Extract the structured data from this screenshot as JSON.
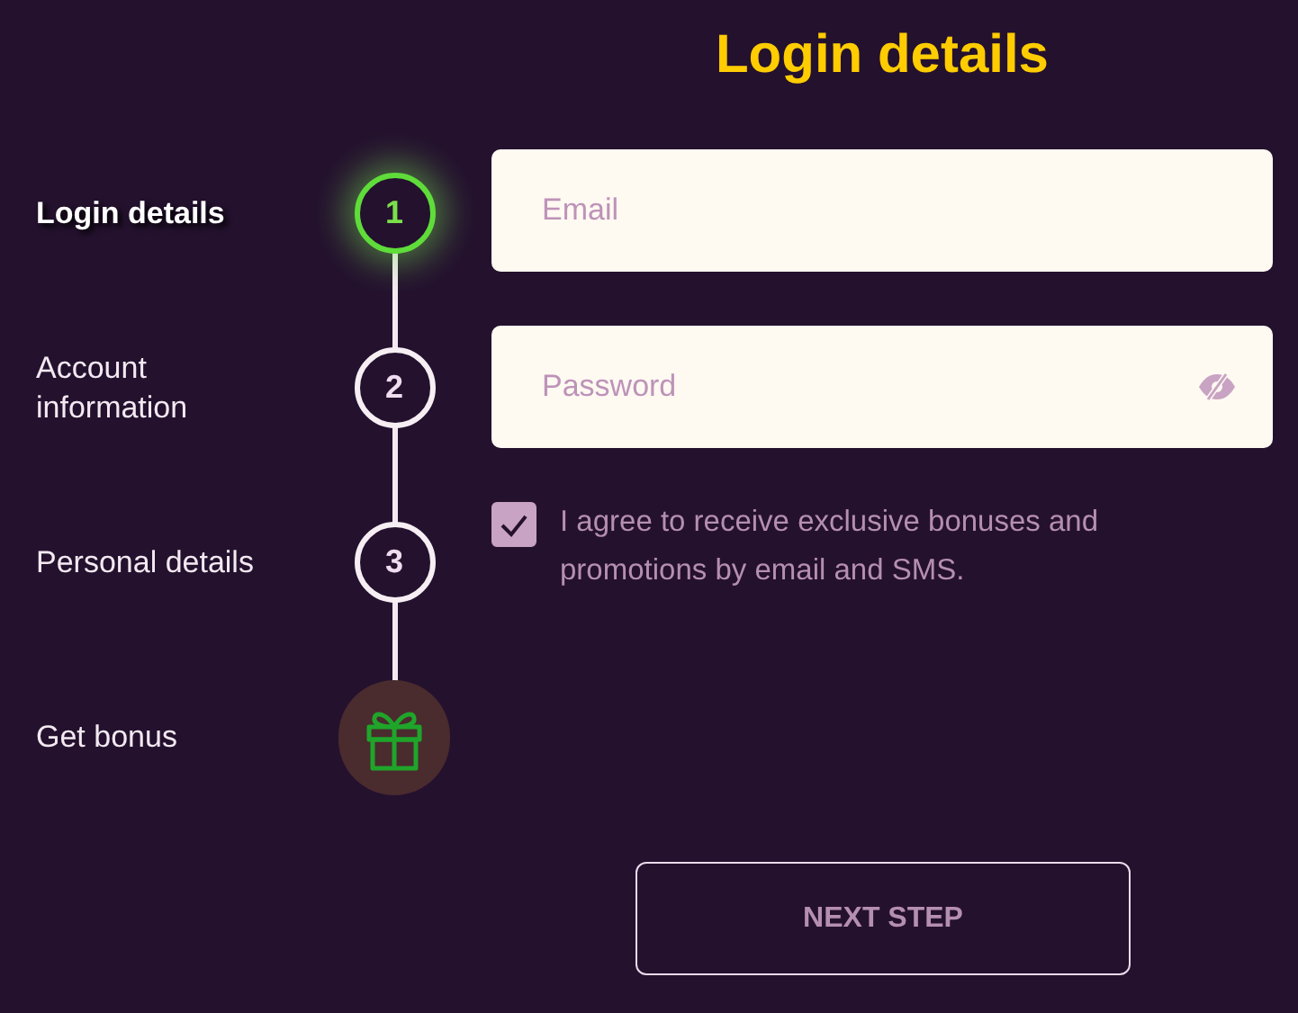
{
  "heading": "Login details",
  "steps": [
    {
      "label": "Login details",
      "kind": "number",
      "number": "1",
      "selected": true
    },
    {
      "label": "Account information",
      "kind": "number",
      "number": "2",
      "selected": false
    },
    {
      "label": "Personal details",
      "kind": "number",
      "number": "3",
      "selected": false
    },
    {
      "label": "Get bonus",
      "kind": "gift",
      "selected": false
    }
  ],
  "fields": [
    {
      "placeholder": "Email",
      "kind": "text"
    },
    {
      "placeholder": "Password",
      "kind": "password"
    }
  ],
  "consent": {
    "checked": true,
    "text": "I agree to receive exclusive bonuses and promotions by email and SMS."
  },
  "next_button": "NEXT STEP"
}
